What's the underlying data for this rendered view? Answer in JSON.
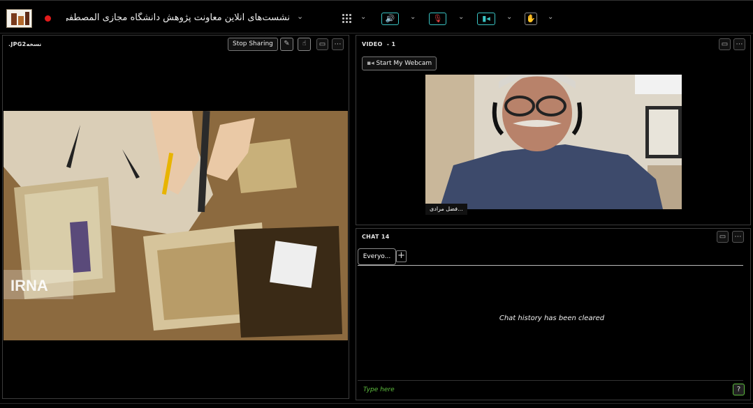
{
  "topbar": {
    "meeting_title": "نشست‌های آنلاین معاونت پژوهش دانشگاه مجازی المصطفی",
    "icons": [
      "logo",
      "recording-dot",
      "chevron-down-icon",
      "grid-icon",
      "speaker-icon",
      "mic-muted-icon",
      "camera-icon",
      "raise-hand-icon"
    ]
  },
  "share_panel": {
    "title": ".JPG2نسخه",
    "stop_sharing_label": "Stop Sharing",
    "watermark": "IRNA"
  },
  "video_panel": {
    "title": "VIDEO",
    "count": "- 1",
    "start_webcam_label": "Start My Webcam",
    "participant_name": "...فضل مرادی"
  },
  "chat_panel": {
    "title": "CHAT 14",
    "tab_label": "Everyo...",
    "cleared_message": "Chat history has been cleared",
    "input_placeholder": "Type here"
  },
  "colors": {
    "accent": "#3ac5c5",
    "record": "#e21b1b",
    "chat_input": "#5fbf3f"
  }
}
